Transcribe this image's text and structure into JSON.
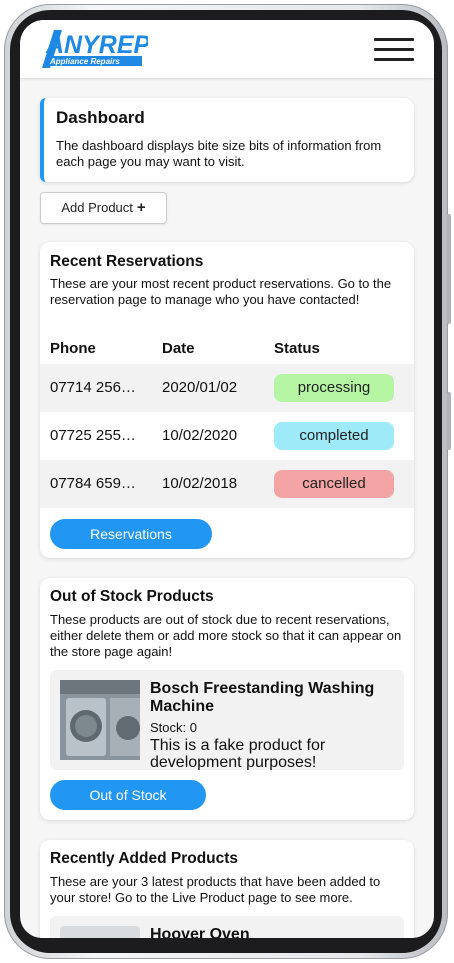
{
  "header": {
    "logo_text": "ANYREP",
    "logo_subtitle": "Appliance Repairs"
  },
  "dashboard": {
    "title": "Dashboard",
    "description": "The dashboard displays bite size bits of information from each page you may want to visit."
  },
  "add_product_label": "Add Product",
  "add_product_icon": "+",
  "reservations": {
    "title": "Recent Reservations",
    "description": "These are your most recent product reservations. Go to the reservation page to manage who you have contacted!",
    "columns": [
      "Phone",
      "Date",
      "Status"
    ],
    "rows": [
      {
        "phone": "07714 256…",
        "date": "2020/01/02",
        "status": "processing",
        "status_color": "#b6f5a3"
      },
      {
        "phone": "07725 255…",
        "date": "10/02/2020",
        "status": "completed",
        "status_color": "#9eeaf9"
      },
      {
        "phone": "07784 659…",
        "date": "10/02/2018",
        "status": "cancelled",
        "status_color": "#f4a4a4"
      }
    ],
    "button_label": "Reservations"
  },
  "out_of_stock": {
    "title": "Out of Stock Products",
    "description": "These products are out of stock due to recent reservations, either delete them or add more stock so that it can appear on the store page again!",
    "product": {
      "name": "Bosch Freestanding Washing Machine",
      "stock": "Stock: 0",
      "description": "This is a fake product for development purposes!"
    },
    "button_label": "Out of Stock"
  },
  "recently_added": {
    "title": "Recently Added Products",
    "description": "These are your 3 latest products that have been added to your store! Go to the Live Product page to see more.",
    "product_name": "Hoover Oven"
  },
  "colors": {
    "accent": "#2196f3"
  }
}
